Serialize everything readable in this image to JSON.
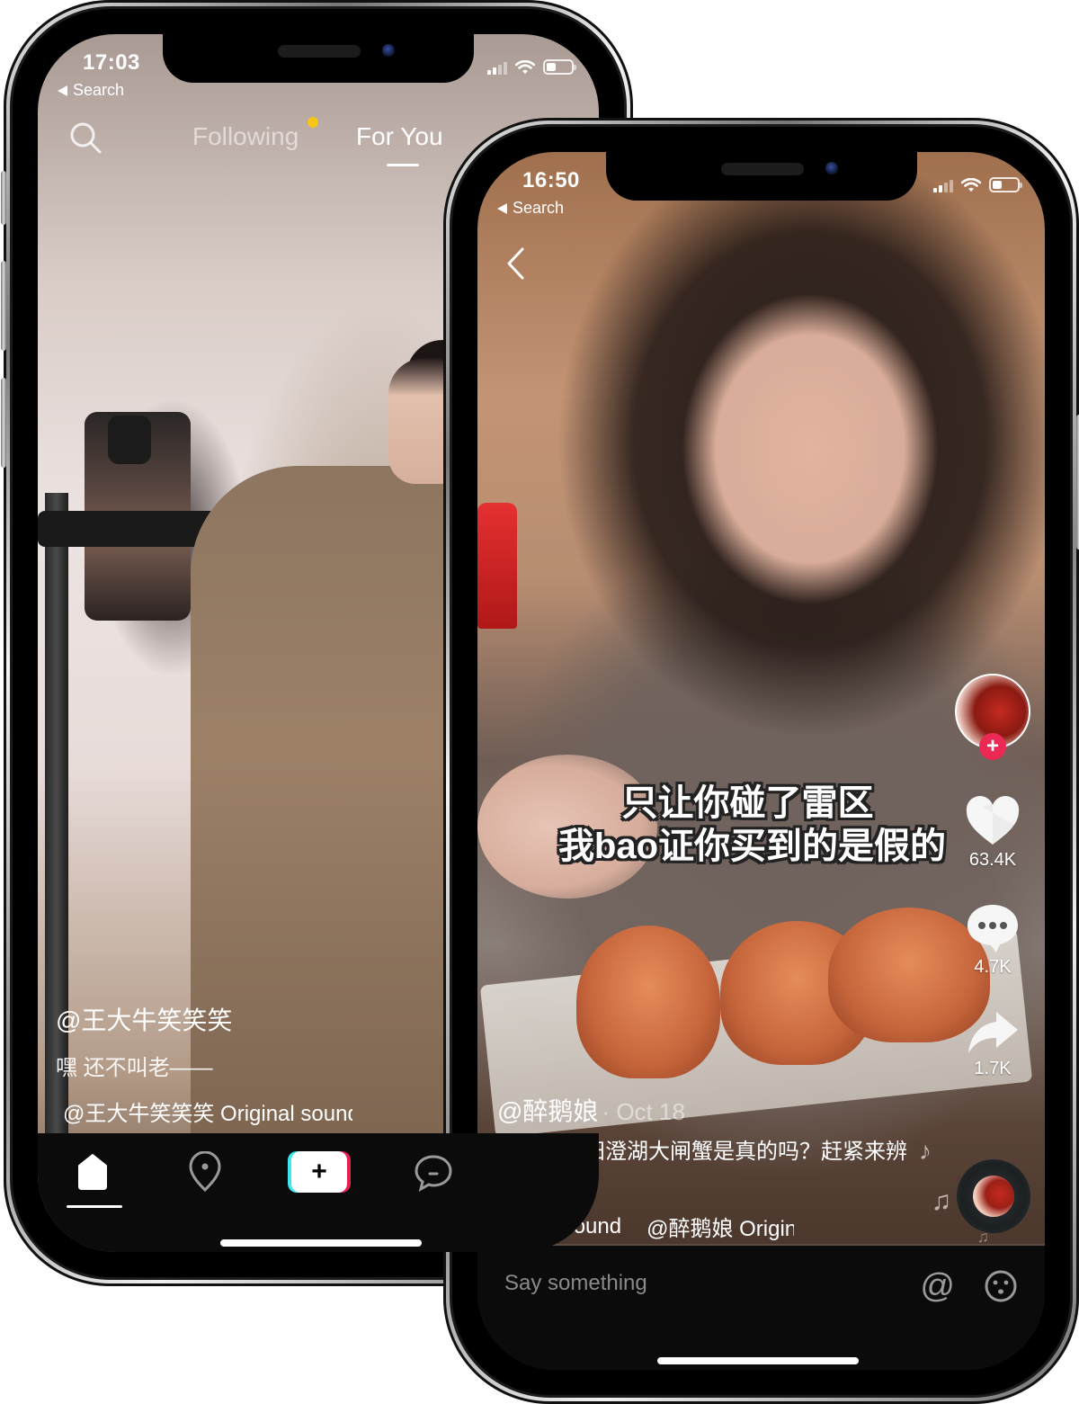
{
  "phone_left": {
    "status_bar": {
      "time": "17:03",
      "back_label": "Search"
    },
    "top_nav": {
      "search_icon": "search-icon",
      "tabs": [
        {
          "label": "Following",
          "active": false,
          "has_notification_dot": true
        },
        {
          "label": "For You",
          "active": true
        }
      ],
      "notification_dot_color": "#f5c518"
    },
    "caption": {
      "username": "@王大牛笑笑笑",
      "description": "嘿  还不叫老——",
      "sound": "@王大牛笑笑笑 Original sound"
    },
    "bottom_nav": [
      {
        "name": "home",
        "icon": "home-icon",
        "active": true
      },
      {
        "name": "discover",
        "icon": "location-pin-icon",
        "active": false
      },
      {
        "name": "create",
        "icon": "plus-icon",
        "label": "+"
      },
      {
        "name": "inbox",
        "icon": "message-bubble-icon",
        "active": false
      }
    ],
    "brand_colors": {
      "cyan": "#3de6f0",
      "red": "#e8204f"
    }
  },
  "phone_right": {
    "status_bar": {
      "time": "16:50",
      "back_label": "Search"
    },
    "subtitle": {
      "line1": "只让你碰了雷区",
      "line2": "我bao证你买到的是假的"
    },
    "actions": {
      "follow_label": "+",
      "follow_color": "#ea2a55",
      "likes": "63.4K",
      "comments": "4.7K",
      "shares": "1.7K"
    },
    "caption": {
      "username": "@醉鹅娘",
      "date": "· Oct 18",
      "description": "你买到的阳澄湖大闸蟹是真的吗？赶紧来辨别一下",
      "sound_a": "iginal sound",
      "sound_b": "@醉鹅娘 Original sound"
    },
    "progress": 0.12,
    "comment_bar": {
      "placeholder": "Say something",
      "mention_label": "@"
    }
  }
}
